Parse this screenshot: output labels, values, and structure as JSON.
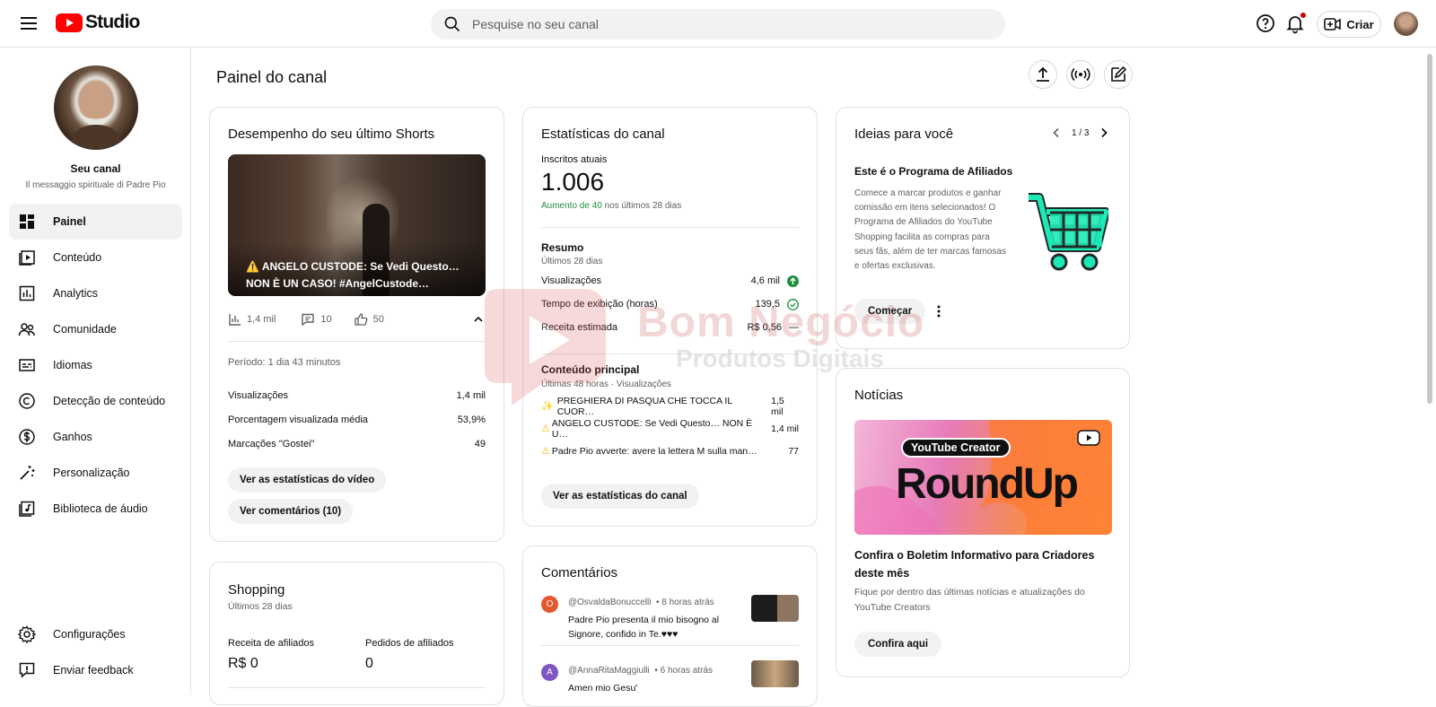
{
  "header": {
    "logo_text": "Studio",
    "search_placeholder": "Pesquise no seu canal",
    "create_label": "Criar"
  },
  "sidebar": {
    "channel_name": "Seu canal",
    "channel_subtitle": "Il messaggio spirituale di Padre Pio",
    "items": [
      {
        "label": "Painel",
        "icon": "dashboard-icon",
        "active": true
      },
      {
        "label": "Conteúdo",
        "icon": "content-icon"
      },
      {
        "label": "Analytics",
        "icon": "analytics-icon"
      },
      {
        "label": "Comunidade",
        "icon": "community-icon"
      },
      {
        "label": "Idiomas",
        "icon": "subtitles-icon"
      },
      {
        "label": "Detecção de conteúdo",
        "icon": "copyright-icon"
      },
      {
        "label": "Ganhos",
        "icon": "dollar-icon"
      },
      {
        "label": "Personalização",
        "icon": "magic-wand-icon"
      },
      {
        "label": "Biblioteca de áudio",
        "icon": "audio-library-icon"
      }
    ],
    "bottom_items": [
      {
        "label": "Configurações",
        "icon": "gear-icon"
      },
      {
        "label": "Enviar feedback",
        "icon": "feedback-icon"
      }
    ]
  },
  "main": {
    "title": "Painel do canal",
    "last_short": {
      "title": "Desempenho do seu último Shorts",
      "video_title": "⚠️ ANGELO CUSTODE: Se Vedi Questo… NON È UN CASO! #AngelCustode…",
      "views_short": "1,4 mil",
      "comments": "10",
      "likes": "50",
      "period": "Período: 1 dia 43 minutos",
      "stats": [
        {
          "label": "Visualizações",
          "value": "1,4 mil"
        },
        {
          "label": "Porcentagem visualizada média",
          "value": "53,9%"
        },
        {
          "label": "Marcações \"Gostei\"",
          "value": "49"
        }
      ],
      "btn_stats": "Ver as estatísticas do vídeo",
      "btn_comments": "Ver comentários (10)"
    },
    "shopping": {
      "title": "Shopping",
      "subtitle": "Últimos 28 dias",
      "revenue_label": "Receita de afiliados",
      "revenue_value": "R$ 0",
      "orders_label": "Pedidos de afiliados",
      "orders_value": "0"
    },
    "channel_stats": {
      "title": "Estatísticas do canal",
      "subs_label": "Inscritos atuais",
      "subs_value": "1.006",
      "increase_prefix": "Aumento de 40",
      "increase_suffix": " nos últimos 28 dias",
      "summary_title": "Resumo",
      "summary_sub": "Últimos 28 dias",
      "summary": [
        {
          "label": "Visualizações",
          "value": "4,6 mil"
        },
        {
          "label": "Tempo de exibição (horas)",
          "value": "139,5"
        },
        {
          "label": "Receita estimada",
          "value": "R$ 0,56",
          "suffix": "—"
        }
      ],
      "top_title": "Conteúdo principal",
      "top_sub": "Últimas 48 horas · Visualizações",
      "top_content": [
        {
          "label": "PREGHIERA DI PASQUA CHE TOCCA IL CUOR…",
          "value": "1,5 mil"
        },
        {
          "label": "ANGELO CUSTODE: Se Vedi Questo… NON È U…",
          "value": "1,4 mil"
        },
        {
          "label": "Padre Pio avverte: avere la lettera M sulla man…",
          "value": "77"
        }
      ],
      "btn": "Ver as estatísticas do canal"
    },
    "comments": {
      "title": "Comentários",
      "items": [
        {
          "initial": "O",
          "color": "#e4572e",
          "author": "@OsvaldaBonuccelli",
          "time": "• 8 horas atrás",
          "text": "Padre Pio presenta il mio bisogno al Signore, confido in Te.♥♥♥"
        },
        {
          "initial": "A",
          "color": "#7e57c2",
          "author": "@AnnaRitaMaggiulli",
          "time": "• 6 horas atrás",
          "text": "Amen mio Gesu'"
        }
      ]
    },
    "ideas": {
      "title": "Ideias para você",
      "pager": "1 / 3",
      "headline": "Este é o Programa de Afiliados",
      "body": "Comece a marcar produtos e ganhar comissão em itens selecionados! O Programa de Afiliados do YouTube Shopping facilita as compras para seus fãs, além de ter marcas famosas e ofertas exclusivas.",
      "btn": "Começar",
      "accent": "#1de9b6"
    },
    "news": {
      "title": "Notícias",
      "banner_top": "YouTube Creator",
      "banner_main": "RoundUp",
      "headline": "Confira o Boletim Informativo para Criadores deste mês",
      "body": "Fique por dentro das últimas notícias e atualizações do YouTube Creators",
      "btn": "Confira aqui"
    }
  },
  "watermark": {
    "line1": "Bom Negócio",
    "line2": "Produtos Digitais"
  }
}
